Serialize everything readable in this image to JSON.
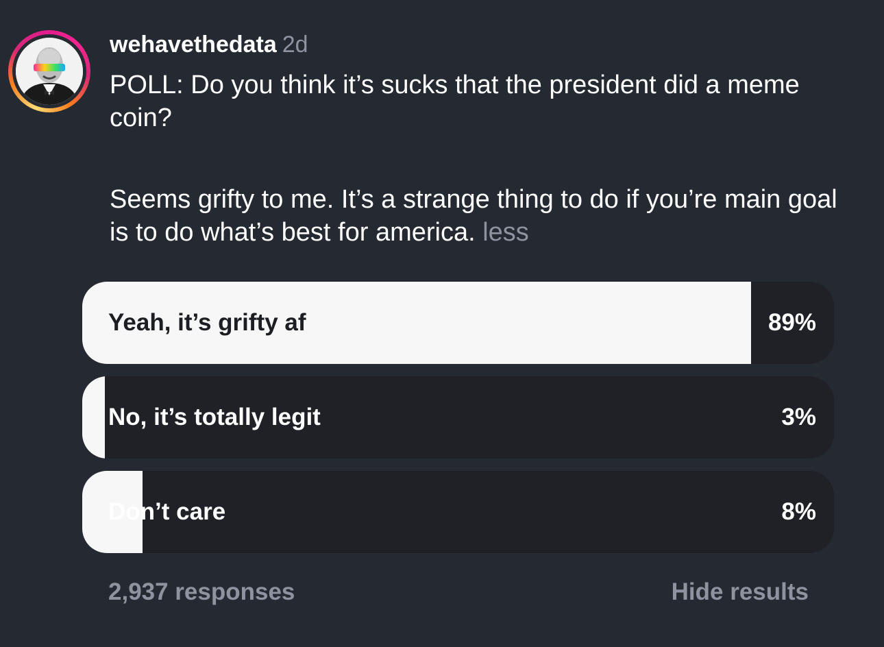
{
  "post": {
    "username": "wehavethedata",
    "timestamp": "2d",
    "title_text": "POLL: Do you think it’s sucks that the president did a meme coin?",
    "body_text": "Seems grifty to me. It’s a strange thing to do if you’re main goal is to do what’s best for america.",
    "less_label": "less",
    "avatar_icon": "user-avatar-photo"
  },
  "poll": {
    "options": [
      {
        "label": "Yeah, it’s grifty af",
        "percent_label": "89%",
        "percent": 89
      },
      {
        "label": "No, it’s totally legit",
        "percent_label": "3%",
        "percent": 3
      },
      {
        "label": "Don’t care",
        "percent_label": "8%",
        "percent": 8
      }
    ],
    "responses_label": "2,937 responses",
    "hide_results_label": "Hide results"
  },
  "colors": {
    "background": "#252932",
    "option_track": "#1f2127",
    "option_fill": "#f7f7f7",
    "muted_text": "#8e93a0",
    "story_ring": [
      "#feda75",
      "#fa7e1e",
      "#d62976",
      "#e11d8c"
    ]
  }
}
